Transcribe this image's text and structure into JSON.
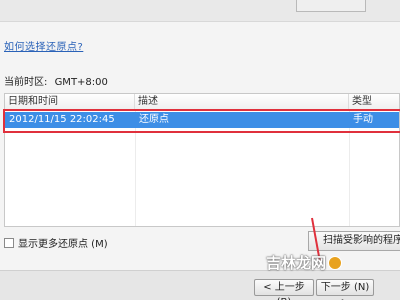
{
  "help_link": "如何选择还原点?",
  "timezone": {
    "label": "当前时区:",
    "value": "GMT+8:00"
  },
  "list": {
    "columns": [
      "日期和时间",
      "描述",
      "类型"
    ],
    "rows": [
      {
        "datetime": "2012/11/15 22:02:45",
        "description": "还原点",
        "type": "手动"
      }
    ]
  },
  "show_more": {
    "label": "显示更多还原点 (M)",
    "checked": false
  },
  "scan_button": {
    "label": "扫描受影响的程序"
  },
  "footer": {
    "back_label": "< 上一步 (B)",
    "next_label": "下一步 (N) >"
  },
  "watermark": {
    "text": "吉林龙网"
  },
  "colors": {
    "selection": "#3d8ee6",
    "highlight_border": "#e0303c",
    "link": "#2a62b8"
  }
}
